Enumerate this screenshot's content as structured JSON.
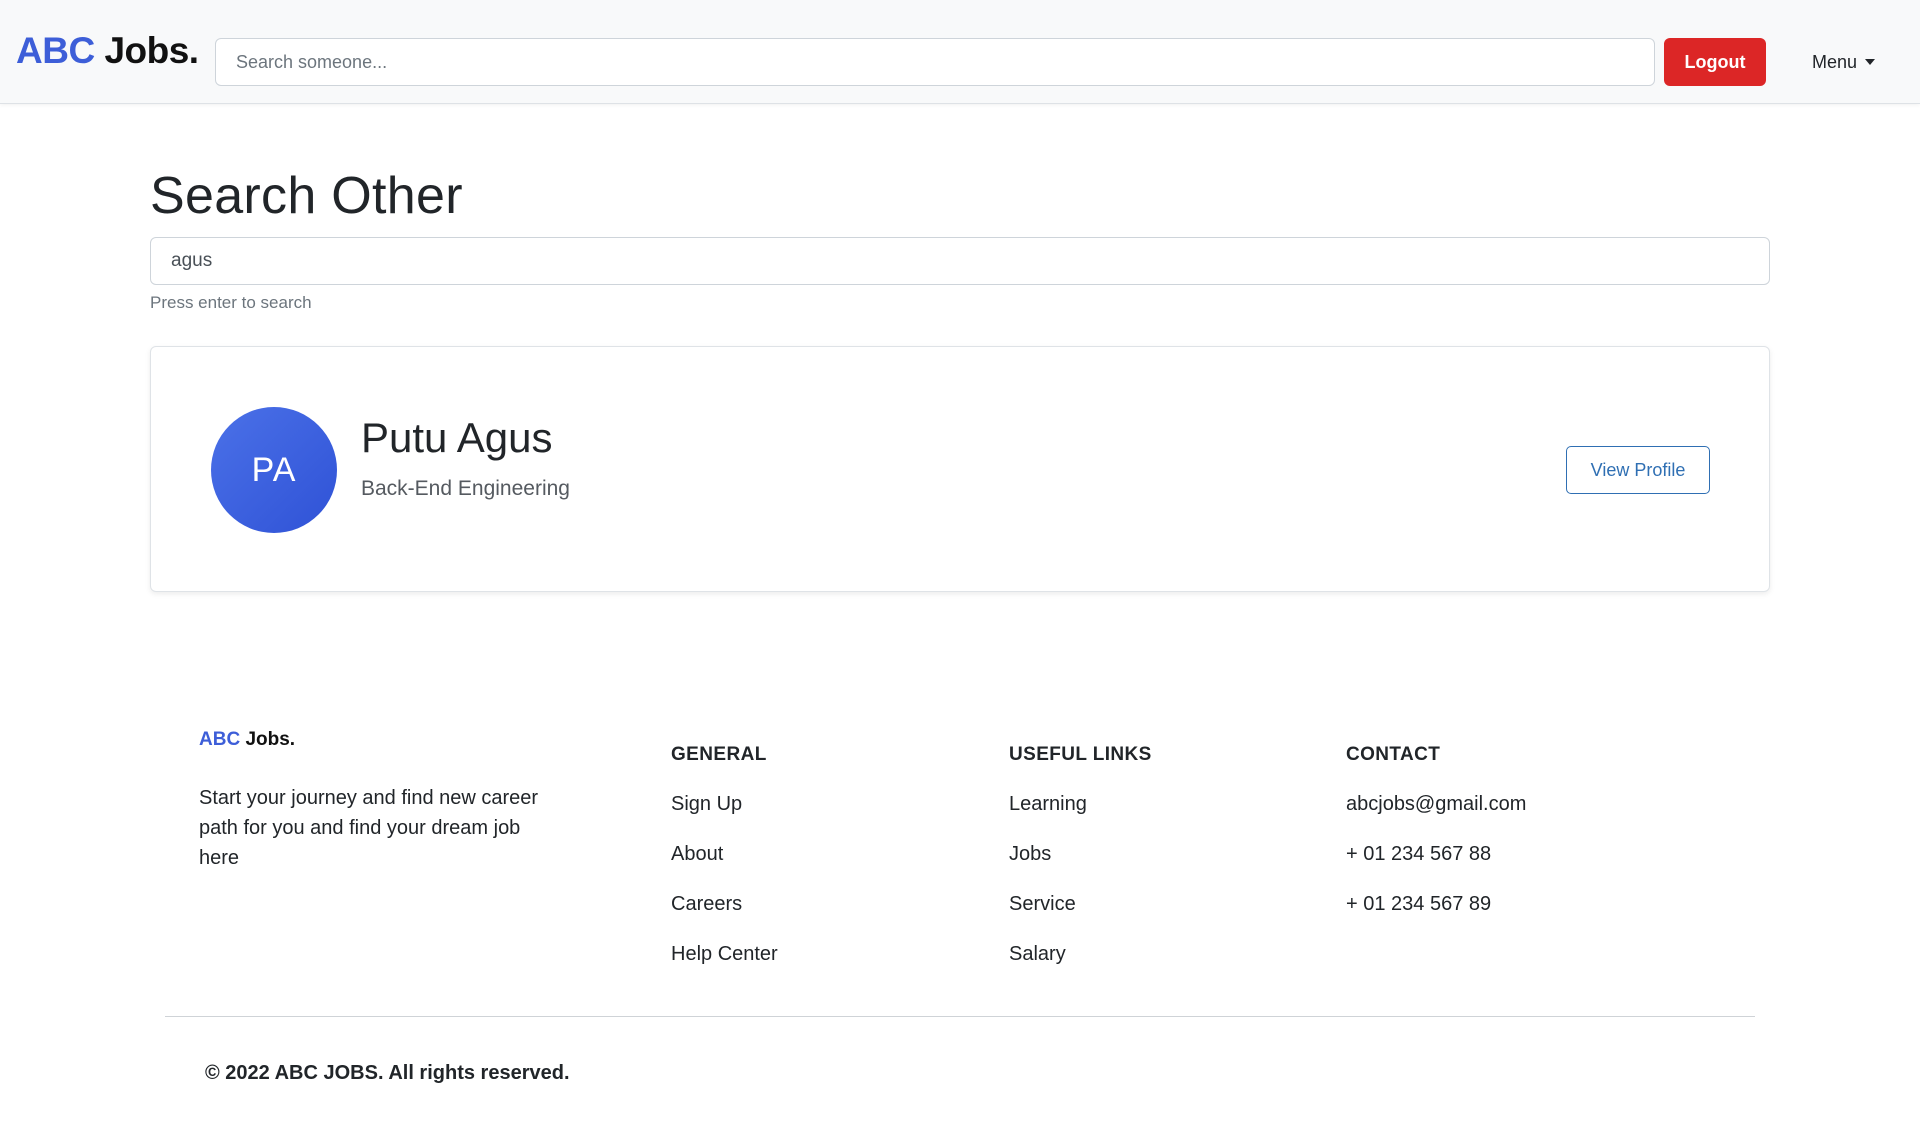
{
  "navbar": {
    "brand_abc": "ABC",
    "brand_jobs": "Jobs.",
    "search_placeholder": "Search someone...",
    "logout_label": "Logout",
    "menu_label": "Menu"
  },
  "main": {
    "title": "Search Other",
    "search_value": "agus",
    "hint": "Press enter to search",
    "results": [
      {
        "initials": "PA",
        "name": "Putu Agus",
        "role": "Back-End Engineering",
        "action_label": "View Profile"
      }
    ],
    "avatar_color": "#3d5ed8"
  },
  "footer": {
    "brand_abc": "ABC",
    "brand_jobs": "Jobs.",
    "tagline": "Start your journey and find new career path for you and find your dream job here",
    "general": {
      "heading": "GENERAL",
      "items": [
        "Sign Up",
        "About",
        "Careers",
        "Help Center"
      ]
    },
    "useful_links": {
      "heading": "USEFUL LINKS",
      "items": [
        "Learning",
        "Jobs",
        "Service",
        "Salary"
      ]
    },
    "contact": {
      "heading": "CONTACT",
      "items": [
        "abcjobs@gmail.com",
        "+ 01 234 567 88",
        "+ 01 234 567 89"
      ]
    },
    "copyright": "© 2022 ABC JOBS. All rights reserved."
  },
  "colors": {
    "brand": "#3d5ed8",
    "logout": "#dc2626",
    "view_profile": "#2f6fb3"
  }
}
